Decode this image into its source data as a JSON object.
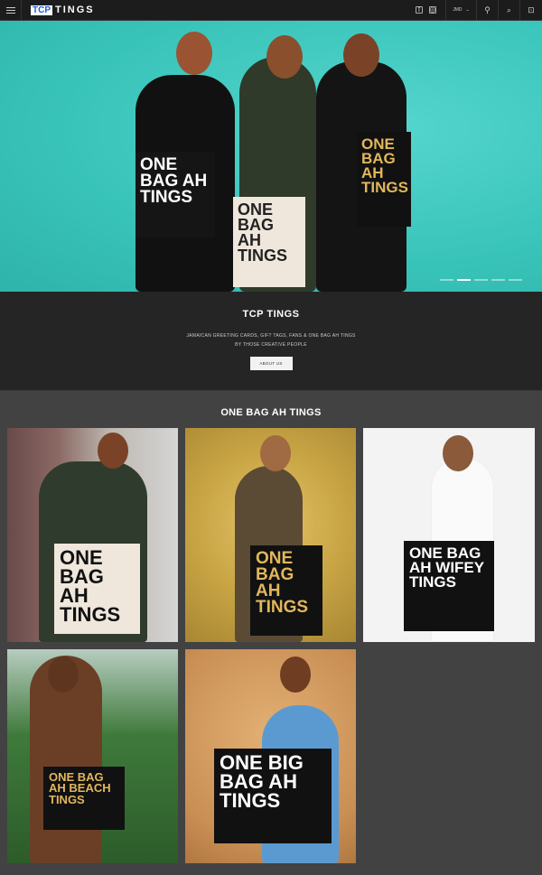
{
  "header": {
    "logo_tcp": "TCP",
    "logo_text": "TINGS",
    "currency": "JMD",
    "social": [
      "facebook-icon",
      "instagram-icon"
    ]
  },
  "hero": {
    "bags": [
      "ONE BAG AH TINGS",
      "ONE BAG AH TINGS",
      "ONE BAG AH TINGS"
    ],
    "slide_count": 5,
    "active_slide": 2
  },
  "about": {
    "title": "TCP TINGS",
    "line1": "JAMAICAN GREETING CARDS, GIFT TAGS, FANS & ONE BAG AH TINGS",
    "line2": "BY THOSE CREATIVE PEOPLE",
    "button": "ABOUT US"
  },
  "products": {
    "title": "ONE BAG AH TINGS",
    "items": [
      {
        "bag_text": "ONE BAG AH TINGS"
      },
      {
        "bag_text": "ONE BAG AH TINGS"
      },
      {
        "bag_text": "ONE BAG AH WIFEY TINGS"
      },
      {
        "bag_text": "ONE BAG AH BEACH TINGS"
      },
      {
        "bag_text": "ONE BIG BAG AH TINGS"
      }
    ]
  },
  "colors": {
    "header_bg": "#1c1c1c",
    "hero_wall": "#3ecbc1",
    "about_bg": "#252525",
    "products_bg": "#424242",
    "gold": "#e2b75b",
    "logo_blue": "#1e5ad8"
  }
}
